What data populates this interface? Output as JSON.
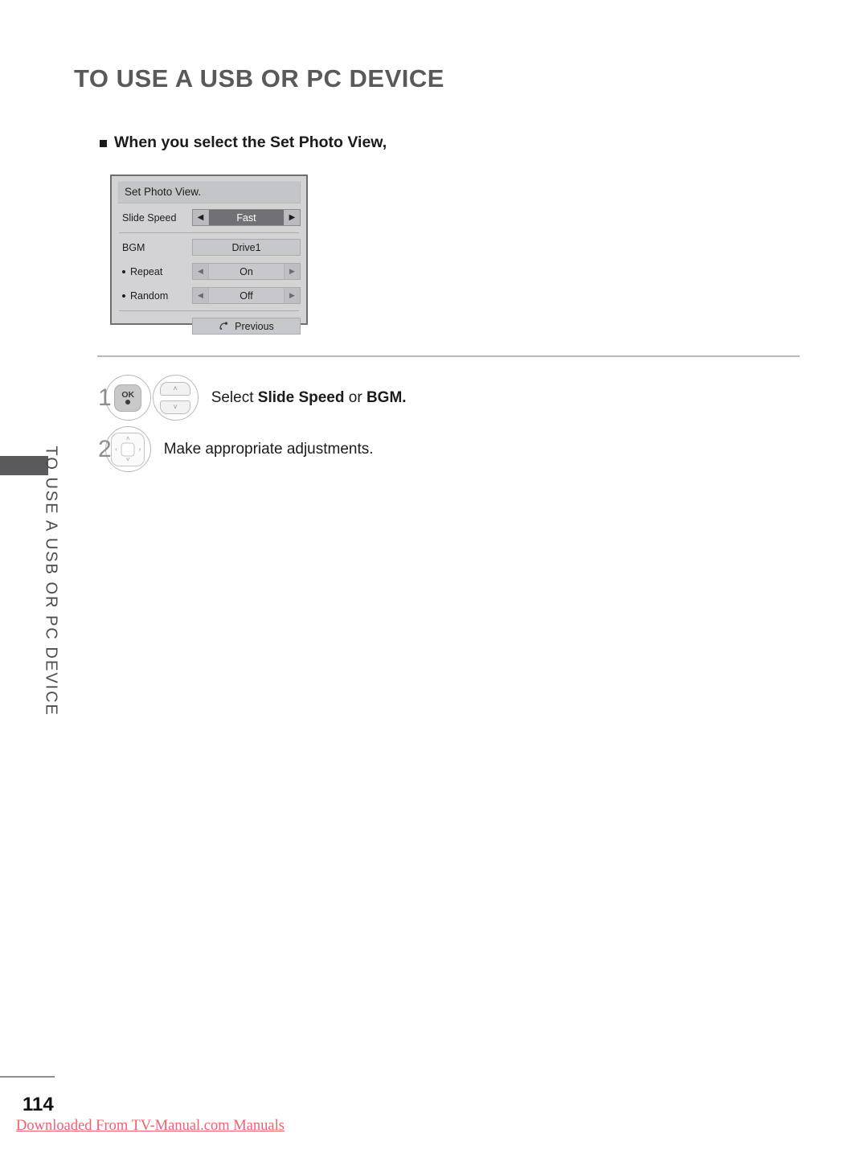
{
  "header": {
    "title": "TO USE A USB OR PC DEVICE",
    "section_title": "When you select the Set Photo View,",
    "bullet_icon": "filled-square-bullet"
  },
  "osd_dialog": {
    "title": "Set Photo View.",
    "rows": [
      {
        "label": "Slide Speed",
        "value": "Fast",
        "control": "stepper",
        "selected": true,
        "left_arrow": "◀",
        "right_arrow": "▶"
      },
      {
        "label": "BGM",
        "value": "Drive1",
        "control": "button",
        "selected": false
      },
      {
        "label": "Repeat",
        "value": "On",
        "control": "stepper",
        "selected": false,
        "bullet": true,
        "left_arrow": "◀",
        "right_arrow": "▶"
      },
      {
        "label": "Random",
        "value": "Off",
        "control": "stepper",
        "selected": false,
        "bullet": true,
        "left_arrow": "◀",
        "right_arrow": "▶"
      }
    ],
    "previous_button": {
      "label": "Previous",
      "icon": "return-arrow-icon"
    }
  },
  "steps": [
    {
      "number": "1",
      "keys": [
        "ok-button-key",
        "up-down-rocker-key"
      ],
      "ok_label": "OK",
      "up_arrow": "˄",
      "down_arrow": "˅",
      "text_prefix": "Select ",
      "text_bold1": "Slide Speed",
      "text_middle": " or ",
      "text_bold2": "BGM."
    },
    {
      "number": "2",
      "keys": [
        "four-way-navigation-key"
      ],
      "nav_up": "˄",
      "nav_down": "˅",
      "nav_left": "‹",
      "nav_right": "›",
      "text": "Make appropriate adjustments."
    }
  ],
  "side_tab": {
    "label": "TO USE A USB OR PC DEVICE"
  },
  "footer": {
    "page_number": "114",
    "download_note": "Downloaded From TV-Manual.com Manuals"
  },
  "colors": {
    "heading": "#595959",
    "divider": "#b0bcc0",
    "osd_background": "#d3d3d6",
    "osd_selected": "#6f7175",
    "side_tab": "#5a5a5c",
    "download_note": "#f4606a"
  }
}
